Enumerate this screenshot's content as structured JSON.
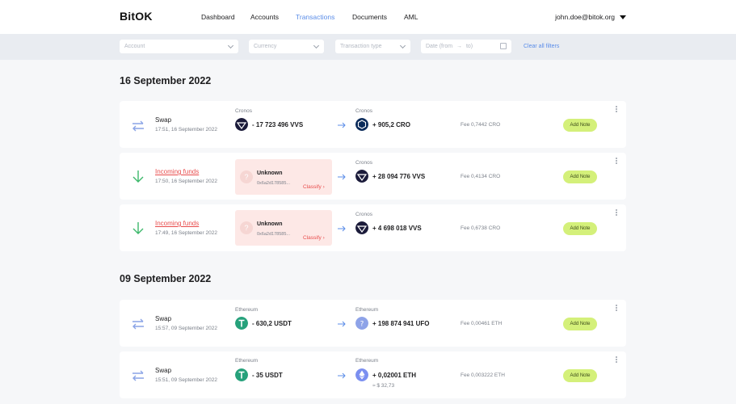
{
  "header": {
    "logo": "BitOK",
    "nav": [
      "Dashboard",
      "Accounts",
      "Transactions",
      "Documents",
      "AML"
    ],
    "active": "Transactions",
    "user": "john.doe@bitok.org"
  },
  "filters": {
    "account": "Account",
    "currency": "Currency",
    "type": "Transaction type",
    "date_from": "Date (from",
    "date_arrow": "→",
    "date_to": "to)",
    "clear": "Clear all filters"
  },
  "sections": [
    {
      "title": "16 September 2022",
      "transactions": [
        {
          "type": "Swap",
          "time": "17:51, 16 September 2022",
          "from_network": "Cronos",
          "from_amount": "- 17 723 496 VVS",
          "to_network": "Cronos",
          "to_amount": "+ 905,2 CRO",
          "fee": "Fee 0,7442 CRO",
          "note": "Add Note"
        },
        {
          "type": "Incoming funds",
          "time": "17:50, 16 September 2022",
          "unknown_label": "Unknown",
          "unknown_addr": "0x6a2d178585...",
          "classify": "Classify",
          "to_network": "Cronos",
          "to_amount": "+ 28 094 776 VVS",
          "fee": "Fee 0,4134 CRO",
          "note": "Add Note"
        },
        {
          "type": "Incoming funds",
          "time": "17:49, 16 September 2022",
          "unknown_label": "Unknown",
          "unknown_addr": "0x6a2d178585...",
          "classify": "Classify",
          "to_network": "Cronos",
          "to_amount": "+ 4 698 018 VVS",
          "fee": "Fee 0,6738 CRO",
          "note": "Add Note"
        }
      ]
    },
    {
      "title": "09 September 2022",
      "transactions": [
        {
          "type": "Swap",
          "time": "15:57, 09 September 2022",
          "from_network": "Ethereum",
          "from_amount": "- 630,2 USDT",
          "to_network": "Ethereum",
          "to_amount": "+ 198 874 941 UFO",
          "fee": "Fee 0,00461 ETH",
          "note": "Add Note"
        },
        {
          "type": "Swap",
          "time": "15:51, 09 September 2022",
          "from_network": "Ethereum",
          "from_amount": "- 35 USDT",
          "to_network": "Ethereum",
          "to_amount": "+ 0,02001 ETH",
          "to_usd": "≈ $ 32,73",
          "fee": "Fee 0,003222 ETH",
          "note": "Add Note"
        }
      ]
    }
  ],
  "colors": {
    "accent": "#5b8de8",
    "incoming": "#e84c4c",
    "note_btn": "#d4f07a",
    "swap_icon": "#8aa4e6",
    "down_icon": "#3db86b"
  }
}
